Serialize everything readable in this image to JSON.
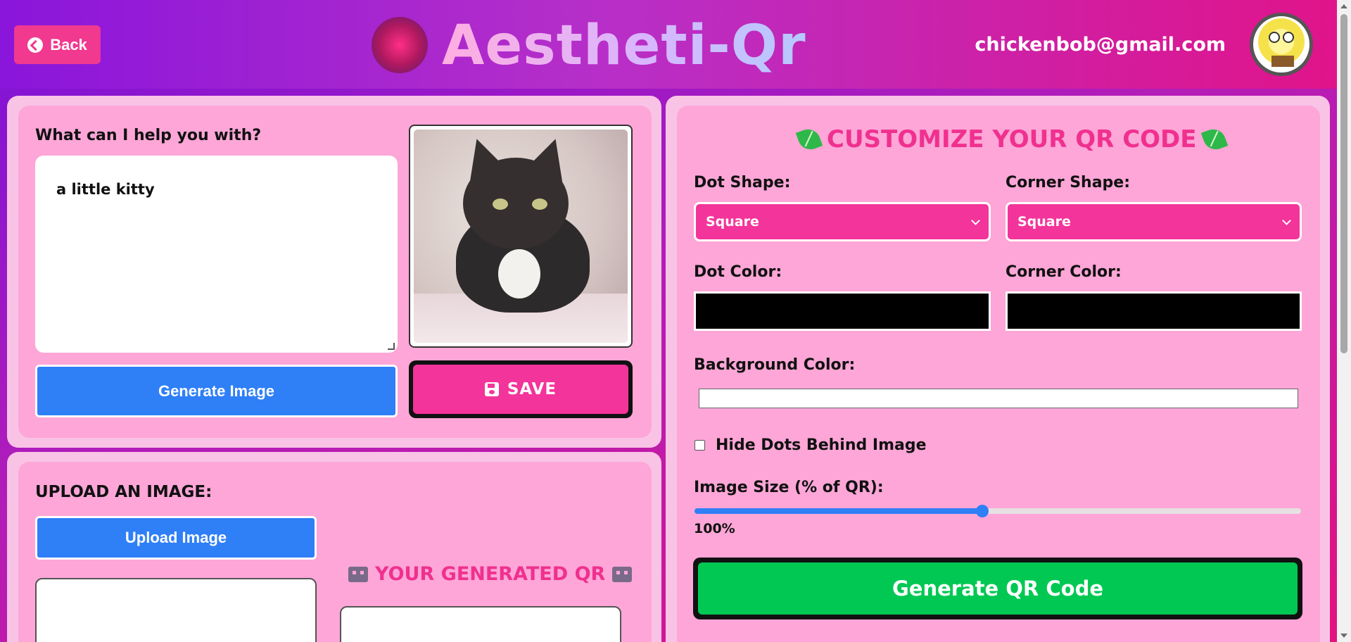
{
  "header": {
    "back_label": "Back",
    "app_title": "Aestheti-Qr",
    "user_email": "chickenbob@gmail.com"
  },
  "prompt_panel": {
    "question": "What can I help you with?",
    "prompt_value": "a little kitty",
    "generate_image_label": "Generate Image",
    "save_label": "SAVE"
  },
  "upload_panel": {
    "heading": "UPLOAD AN IMAGE:",
    "upload_label": "Upload Image",
    "generated_qr_heading": "YOUR GENERATED QR"
  },
  "customize_panel": {
    "title": "CUSTOMIZE YOUR QR CODE",
    "dot_shape_label": "Dot Shape:",
    "dot_shape_value": "Square",
    "corner_shape_label": "Corner Shape:",
    "corner_shape_value": "Square",
    "dot_color_label": "Dot Color:",
    "dot_color_value": "#000000",
    "corner_color_label": "Corner Color:",
    "corner_color_value": "#000000",
    "background_color_label": "Background Color:",
    "background_color_value": "#ffffff",
    "hide_dots_label": "Hide Dots Behind Image",
    "hide_dots_checked": false,
    "image_size_label": "Image Size (% of QR):",
    "image_size_value": "100%",
    "image_size_fraction": 0.475,
    "generate_qr_label": "Generate QR Code"
  },
  "colors": {
    "accent_pink": "#f3349a",
    "button_blue": "#2f7ff7",
    "generate_green": "#00c853"
  }
}
